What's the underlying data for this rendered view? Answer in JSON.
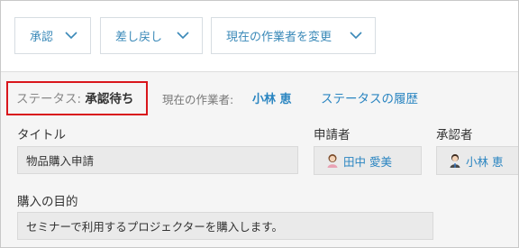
{
  "toolbar": {
    "approve_label": "承認",
    "return_label": "差し戻し",
    "change_worker_label": "現在の作業者を変更"
  },
  "status": {
    "label": "ステータス:",
    "value": "承認待ち",
    "current_worker_label": "現在の作業者:",
    "current_worker_name": "小林 恵",
    "history_link": "ステータスの履歴"
  },
  "form": {
    "title_label": "タイトル",
    "title_value": "物品購入申請",
    "applicant_label": "申請者",
    "applicant_name": "田中 愛美",
    "approver_label": "承認者",
    "approver_name": "小林 恵",
    "purpose_label": "購入の目的",
    "purpose_value": "セミナーで利用するプロジェクターを購入します。"
  },
  "icons": {
    "dropdown": "chevron-down-icon",
    "user_female": "user-avatar-female-icon",
    "user_male": "user-avatar-male-icon"
  }
}
